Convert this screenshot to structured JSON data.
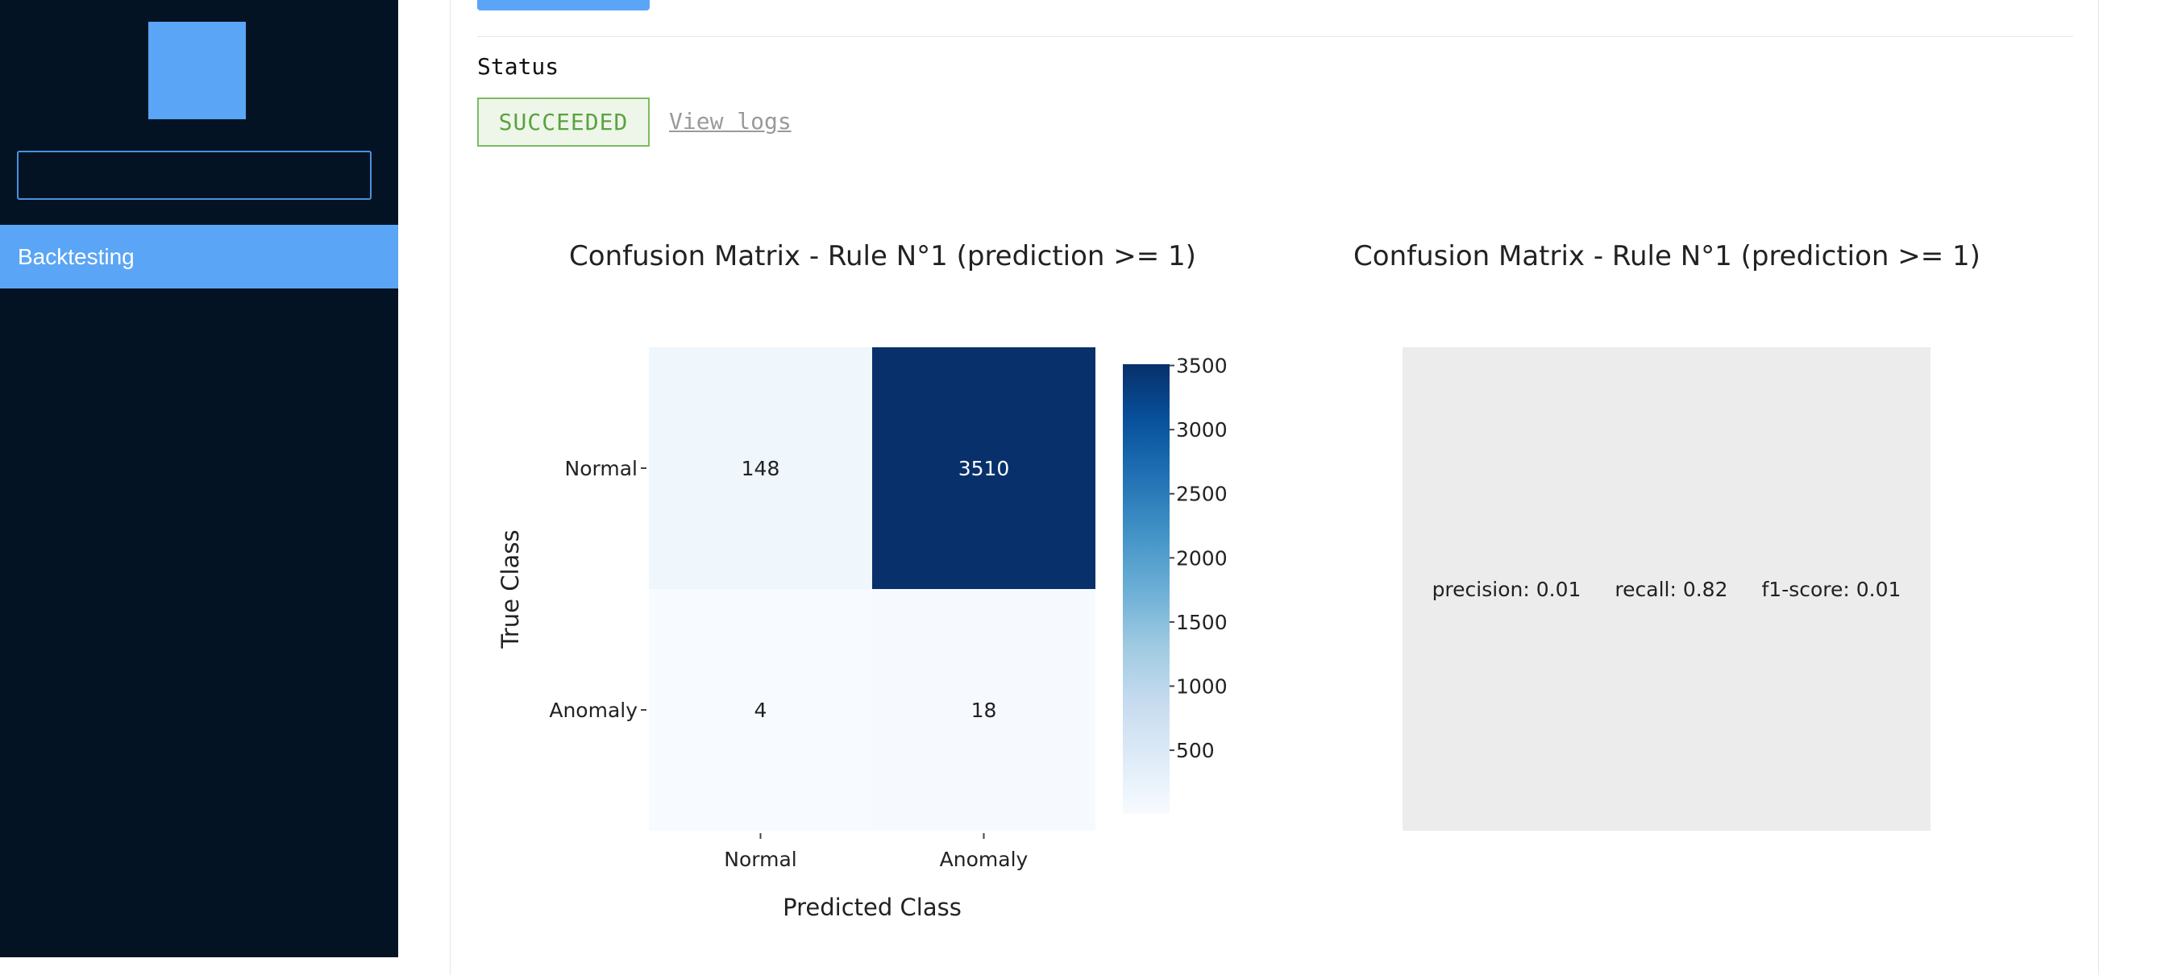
{
  "sidebar": {
    "search_value": "",
    "nav_items": [
      {
        "label": "Backtesting",
        "active": true
      }
    ]
  },
  "status": {
    "label": "Status",
    "badge": "SUCCEEDED",
    "view_logs": "View logs"
  },
  "charts": [
    {
      "title": "Confusion Matrix - Rule N°1 (prediction >= 1)"
    },
    {
      "title": "Confusion Matrix - Rule N°1 (prediction >= 1)"
    }
  ],
  "metrics": {
    "precision": "precision: 0.01",
    "recall": "recall: 0.82",
    "f1": "f1-score: 0.01"
  },
  "chart_data": {
    "type": "heatmap",
    "title": "Confusion Matrix - Rule N°1 (prediction >= 1)",
    "xlabel": "Predicted Class",
    "ylabel": "True Class",
    "x_categories": [
      "Normal",
      "Anomaly"
    ],
    "y_categories": [
      "Normal",
      "Anomaly"
    ],
    "z": [
      [
        148,
        3510
      ],
      [
        4,
        18
      ]
    ],
    "colorscale": "Blues",
    "colorbar_ticks": [
      500,
      1000,
      1500,
      2000,
      2500,
      3000,
      3500
    ],
    "zmin": 4,
    "zmax": 3510
  },
  "colors": {
    "sidebar_bg": "#041324",
    "accent": "#5aa5f6",
    "success": "#5aa33e"
  }
}
